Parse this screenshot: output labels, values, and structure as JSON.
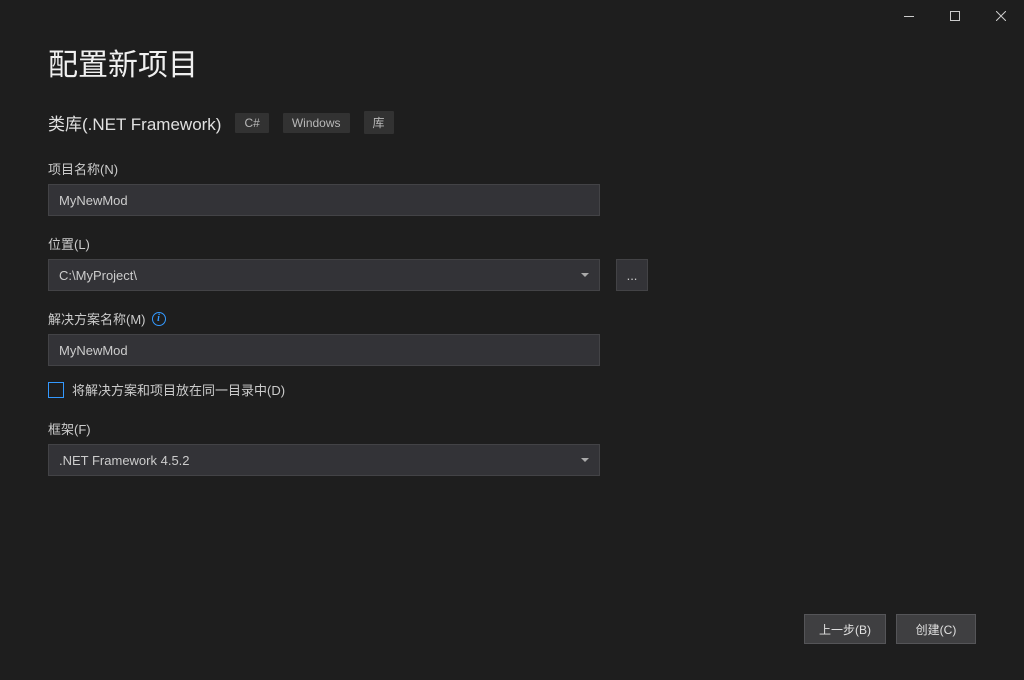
{
  "window": {
    "page_title": "配置新项目",
    "template_name": "类库(.NET Framework)",
    "tags": [
      "C#",
      "Windows",
      "库"
    ]
  },
  "fields": {
    "project_name_label": "项目名称(N)",
    "project_name_value": "MyNewMod",
    "location_label": "位置(L)",
    "location_value": "C:\\MyProject\\",
    "browse_button": "...",
    "solution_name_label": "解决方案名称(M)",
    "solution_name_value": "MyNewMod",
    "same_dir_checkbox_label": "将解决方案和项目放在同一目录中(D)",
    "framework_label": "框架(F)",
    "framework_value": ".NET Framework 4.5.2"
  },
  "footer": {
    "back": "上一步(B)",
    "create": "创建(C)"
  }
}
